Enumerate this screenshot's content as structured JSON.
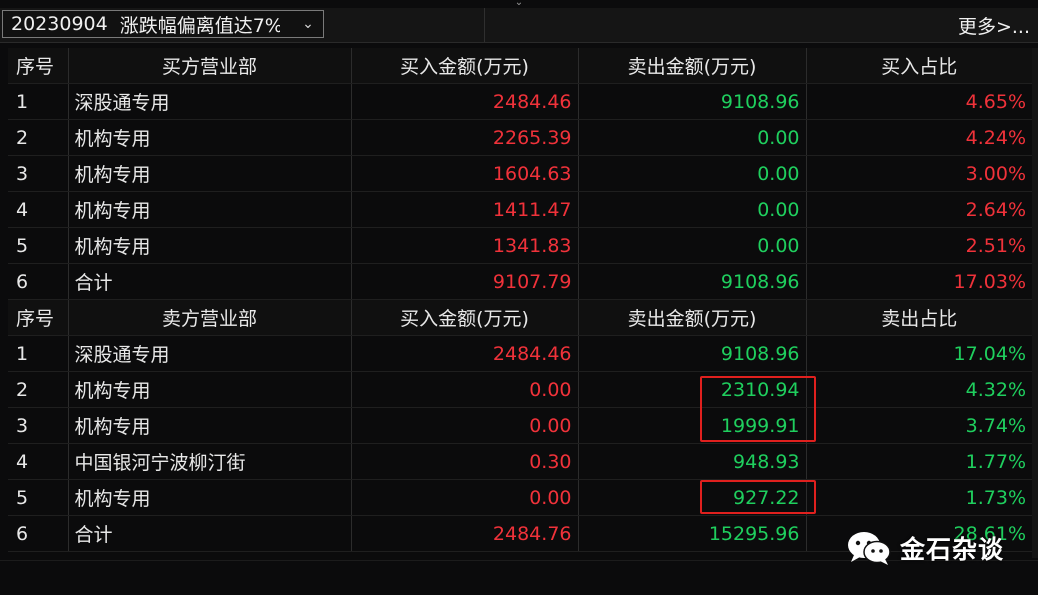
{
  "header": {
    "date": "20230904",
    "filter": "涨跌幅偏离值达7%",
    "more": "更多>..."
  },
  "buy_section": {
    "headers": [
      "序号",
      "买方营业部",
      "买入金额(万元)",
      "卖出金额(万元)",
      "买入占比"
    ],
    "rows": [
      {
        "seq": "1",
        "name": "深股通专用",
        "buy": "2484.46",
        "sell": "9108.96",
        "ratio": "4.65%"
      },
      {
        "seq": "2",
        "name": "机构专用",
        "buy": "2265.39",
        "sell": "0.00",
        "ratio": "4.24%"
      },
      {
        "seq": "3",
        "name": "机构专用",
        "buy": "1604.63",
        "sell": "0.00",
        "ratio": "3.00%"
      },
      {
        "seq": "4",
        "name": "机构专用",
        "buy": "1411.47",
        "sell": "0.00",
        "ratio": "2.64%"
      },
      {
        "seq": "5",
        "name": "机构专用",
        "buy": "1341.83",
        "sell": "0.00",
        "ratio": "2.51%"
      },
      {
        "seq": "6",
        "name": "合计",
        "buy": "9107.79",
        "sell": "9108.96",
        "ratio": "17.03%"
      }
    ]
  },
  "sell_section": {
    "headers": [
      "序号",
      "卖方营业部",
      "买入金额(万元)",
      "卖出金额(万元)",
      "卖出占比"
    ],
    "rows": [
      {
        "seq": "1",
        "name": "深股通专用",
        "buy": "2484.46",
        "sell": "9108.96",
        "ratio": "17.04%"
      },
      {
        "seq": "2",
        "name": "机构专用",
        "buy": "0.00",
        "sell": "2310.94",
        "ratio": "4.32%"
      },
      {
        "seq": "3",
        "name": "机构专用",
        "buy": "0.00",
        "sell": "1999.91",
        "ratio": "3.74%"
      },
      {
        "seq": "4",
        "name": "中国银河宁波柳汀街",
        "buy": "0.30",
        "sell": "948.93",
        "ratio": "1.77%"
      },
      {
        "seq": "5",
        "name": "机构专用",
        "buy": "0.00",
        "sell": "927.22",
        "ratio": "1.73%"
      },
      {
        "seq": "6",
        "name": "合计",
        "buy": "2484.76",
        "sell": "15295.96",
        "ratio": "28.61%"
      }
    ]
  },
  "watermark": {
    "text": "金石杂谈",
    "icon": "wechat-icon"
  },
  "colors": {
    "up": "#f0323a",
    "down": "#1fcf5e",
    "highlight_box": "#e0201e",
    "background": "#0b0b0c"
  }
}
